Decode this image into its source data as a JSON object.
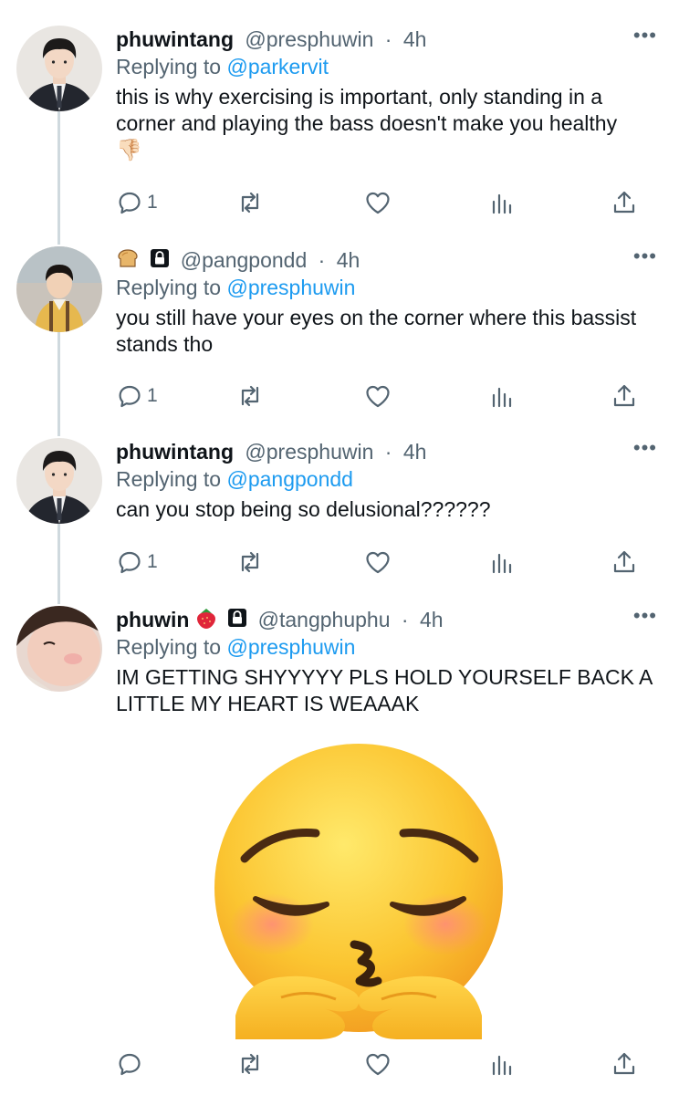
{
  "tweets": [
    {
      "name": "phuwintang",
      "handle": "@presphuwin",
      "time": "4h",
      "replying_prefix": "Replying to",
      "replying_to": "@parkervit",
      "text": "this is why exercising is important, only standing in a corner and playing the bass doesn't make you healthy",
      "text_emoji": "👎🏻",
      "reply_count": "1",
      "avatar_icon": "portrait-boy-suit"
    },
    {
      "name": "",
      "name_icons": [
        "bread-icon",
        "lock-icon"
      ],
      "handle": "@pangpondd",
      "time": "4h",
      "replying_prefix": "Replying to",
      "replying_to": "@presphuwin",
      "text": "you still have your eyes on the corner where this bassist stands tho",
      "reply_count": "1",
      "avatar_icon": "portrait-child"
    },
    {
      "name": "phuwintang",
      "handle": "@presphuwin",
      "time": "4h",
      "replying_prefix": "Replying to",
      "replying_to": "@pangpondd",
      "text": "can you stop being so delusional??????",
      "reply_count": "1",
      "avatar_icon": "portrait-boy-suit"
    },
    {
      "name": "phuwin",
      "name_icons": [
        "strawberry-icon",
        "lock-icon"
      ],
      "handle": "@tangphuphu",
      "time": "4h",
      "replying_prefix": "Replying to",
      "replying_to": "@presphuwin",
      "text": "IM GETTING SHYYYYY PLS HOLD YOURSELF BACK A LITTLE MY HEART IS WEAAAK",
      "reply_count": "",
      "avatar_icon": "portrait-closeup",
      "media_icon": "shy-kissing-emoji"
    }
  ],
  "dot": "·",
  "more": "•••",
  "colors": {
    "accent": "#1d9bf0",
    "muted": "#536471",
    "thread_line": "#cfd9de"
  }
}
